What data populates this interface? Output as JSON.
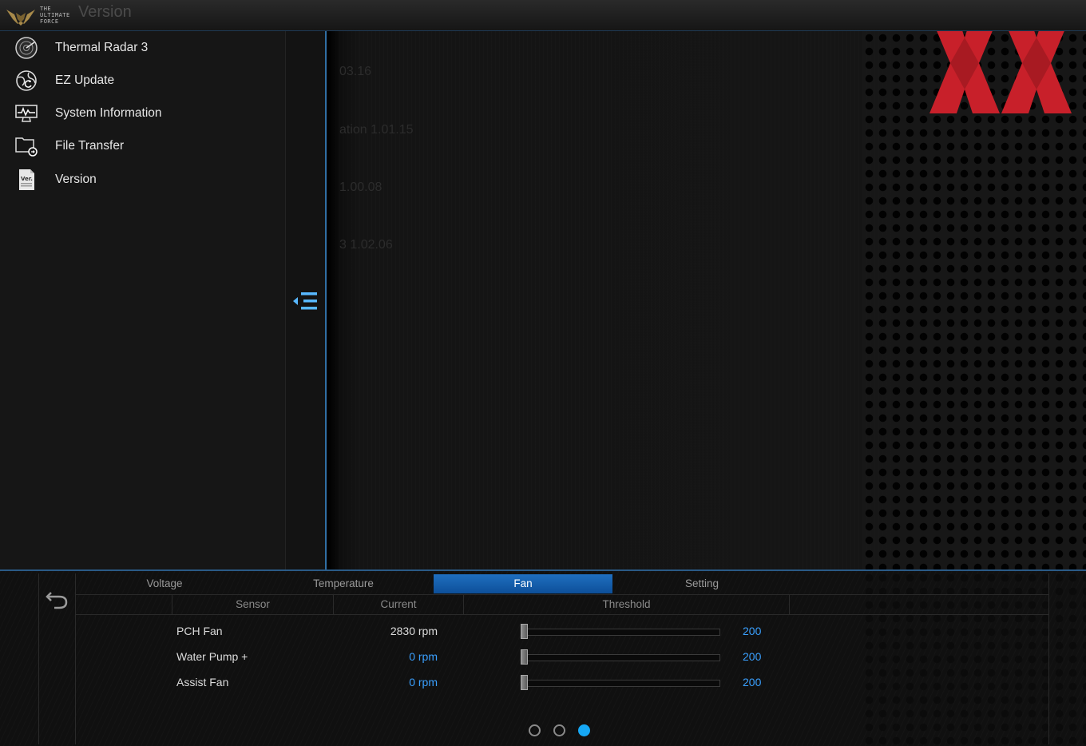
{
  "titlebar": {
    "logo_text": [
      "THE",
      "ULTIMATE",
      "FORCE"
    ],
    "title": "Version"
  },
  "sidebar": {
    "items": [
      {
        "label": "Thermal Radar 3",
        "icon": "radar-icon"
      },
      {
        "label": "EZ Update",
        "icon": "globe-update-icon"
      },
      {
        "label": "System Information",
        "icon": "monitor-info-icon"
      },
      {
        "label": "File Transfer",
        "icon": "file-transfer-icon"
      },
      {
        "label": "Version",
        "icon": "version-document-icon",
        "icon_text": "Ver."
      }
    ]
  },
  "main": {
    "ghost_lines": [
      "03.16",
      "ation   1.01.15",
      "1.00.08",
      "3   1.02.06"
    ],
    "watermark": "XX",
    "watermark_color": "#c8202a"
  },
  "panel": {
    "tabs": [
      "Voltage",
      "Temperature",
      "Fan",
      "Setting"
    ],
    "active_tab": "Fan",
    "columns": [
      "Sensor",
      "Current",
      "Threshold"
    ],
    "rows": [
      {
        "sensor": "PCH Fan",
        "current": "2830 rpm",
        "threshold": "200",
        "current_color": "#dcdcdc",
        "level": 0
      },
      {
        "sensor": "Water Pump +",
        "current": "0 rpm",
        "threshold": "200",
        "current_color": "#3aa0ff",
        "level": 0
      },
      {
        "sensor": "Assist Fan",
        "current": "0 rpm",
        "threshold": "200",
        "current_color": "#3aa0ff",
        "level": 0
      }
    ],
    "pages": 3,
    "active_page": 3
  },
  "colors": {
    "accent": "#1f6fc0",
    "value_blue": "#3aa0ff",
    "active_dot": "#16a8f5"
  }
}
